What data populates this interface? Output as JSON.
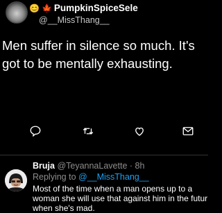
{
  "tweet": {
    "emojis": [
      "😊",
      "🍁"
    ],
    "display_name": "PumpkinSpiceSele",
    "handle": "@__MissThang__",
    "text": "Men suffer in silence so much. It's got to be mentally exhausting."
  },
  "actions": [
    {
      "name": "reply-icon"
    },
    {
      "name": "retweet-icon"
    },
    {
      "name": "like-icon"
    },
    {
      "name": "share-icon"
    }
  ],
  "reply": {
    "display_name": "Bruja",
    "handle_time": "@TeyannaLavette · 8h",
    "replying_prefix": "Replying to ",
    "replying_to": "@__MissThang__",
    "text": "Most of the time when a man opens up to a woman she will use that against him in the futur when she's mad."
  },
  "colors": {
    "background": "#000000",
    "link": "#1da1f2",
    "muted": "#8d8d8d"
  }
}
